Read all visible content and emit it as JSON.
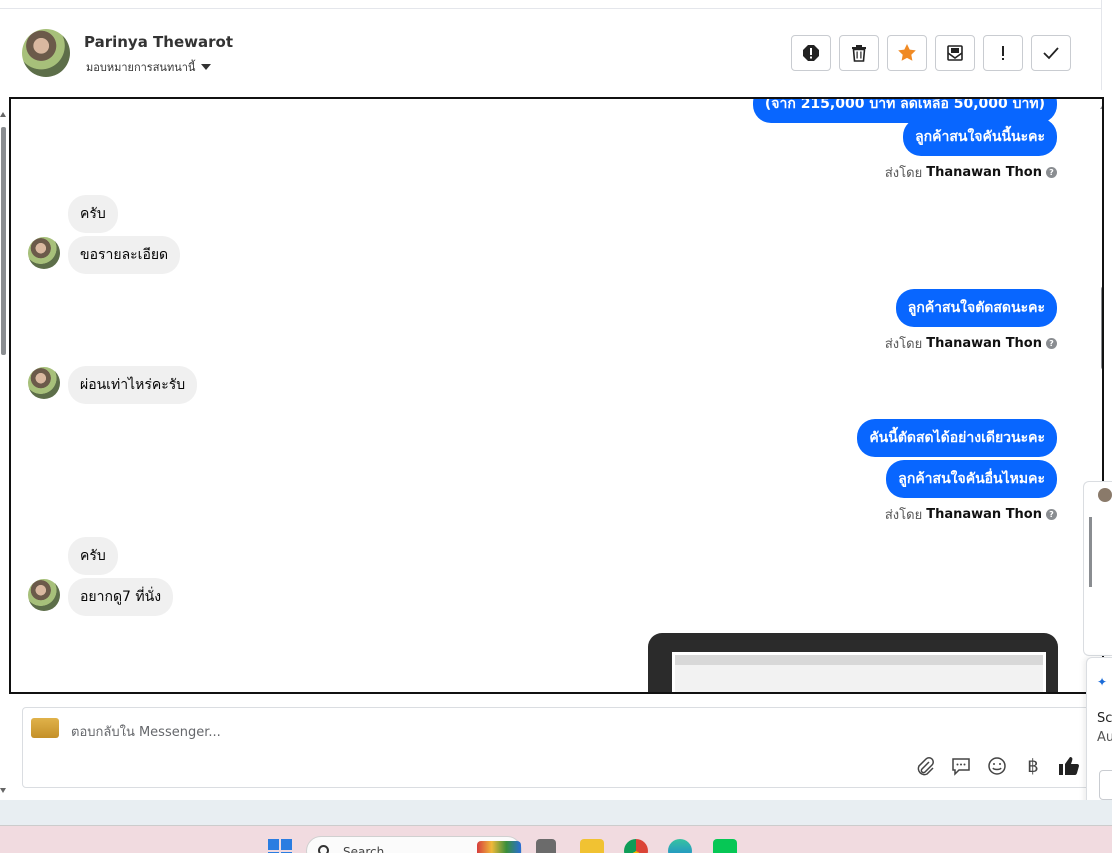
{
  "header": {
    "contact_name": "Parinya Thewarot",
    "assign_label": "มอบหมายการสนทนานี้"
  },
  "actions": [
    {
      "name": "report-icon",
      "label": "!"
    },
    {
      "name": "trash-icon",
      "label": "delete"
    },
    {
      "name": "star-icon",
      "label": "star",
      "color": "#f08a24"
    },
    {
      "name": "mail-icon",
      "label": "mark unread"
    },
    {
      "name": "exclamation-icon",
      "label": "!"
    },
    {
      "name": "check-icon",
      "label": "done"
    }
  ],
  "messages": {
    "out1_partial": "(จาก 215,000 บาท ลดเหลือ 50,000 บาท)",
    "out2": "ลูกค้าสนใจคันนี้นะคะ",
    "in1a": "ครับ",
    "in1b": "ขอรายละเอียด",
    "out3": "ลูกค้าสนใจตัดสดนะคะ",
    "in2": "ผ่อนเท่าไหร่คะรับ",
    "out4a": "คันนี้ตัดสดได้อย่างเดียวนะคะ",
    "out4b": "ลูกค้าสนใจคันอื่นไหมคะ",
    "in3a": "ครับ",
    "in3b": "อยากดู7 ที่นั่ง"
  },
  "sent_by": {
    "prefix": "ส่งโดย",
    "agent": "Thanawan Thon",
    "help": "?"
  },
  "composer": {
    "placeholder": "ตอบกลับใน Messenger...",
    "tools": [
      "paperclip-icon",
      "chat-icon",
      "emoji-icon",
      "baht-icon",
      "thumbs-up-icon"
    ],
    "baht_symbol": "฿"
  },
  "toast": {
    "line1": "Sc",
    "line2": "Au"
  },
  "taskbar": {
    "search_placeholder": "Search"
  },
  "colors": {
    "outgoing_bubble": "#0866ff",
    "incoming_bubble": "#f0f0f0",
    "star": "#f08a24"
  }
}
